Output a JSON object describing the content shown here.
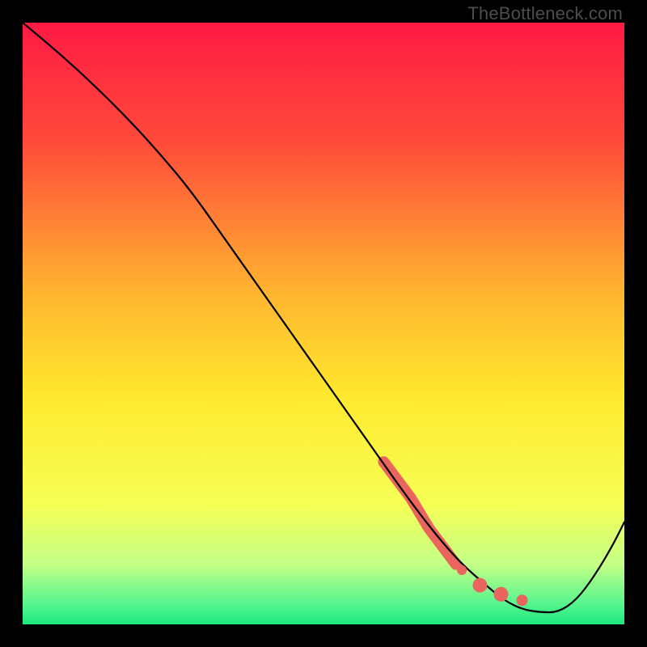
{
  "watermark": "TheBottleneck.com",
  "chart_data": {
    "type": "line",
    "title": "",
    "xlabel": "",
    "ylabel": "",
    "xlim": [
      0,
      100
    ],
    "ylim": [
      0,
      100
    ],
    "grid": false,
    "background_gradient": {
      "stops": [
        {
          "pos": 0.0,
          "color": "#ff1a44"
        },
        {
          "pos": 0.2,
          "color": "#ff4b3a"
        },
        {
          "pos": 0.45,
          "color": "#ffb530"
        },
        {
          "pos": 0.62,
          "color": "#ffe92e"
        },
        {
          "pos": 0.8,
          "color": "#f6ff55"
        },
        {
          "pos": 0.9,
          "color": "#c4ff86"
        },
        {
          "pos": 0.965,
          "color": "#57f58e"
        },
        {
          "pos": 1.0,
          "color": "#1ee87f"
        }
      ]
    },
    "series": [
      {
        "name": "curve",
        "x": [
          0.0,
          6.0,
          12.0,
          18.0,
          23.0,
          28.0,
          34.0,
          40.0,
          46.0,
          52.0,
          58.0,
          64.0,
          69.0,
          73.0,
          77.0,
          80.0,
          83.0,
          86.0,
          89.0,
          92.0,
          95.0,
          98.0,
          100.0
        ],
        "y": [
          100.0,
          95.0,
          89.5,
          83.5,
          78.0,
          72.0,
          63.5,
          55.0,
          46.5,
          38.0,
          29.5,
          21.0,
          14.5,
          10.0,
          6.5,
          4.0,
          2.5,
          2.0,
          2.0,
          4.0,
          8.0,
          13.0,
          17.0
        ],
        "color": "#000000",
        "width": 2.2
      }
    ],
    "highlight_segments": [
      {
        "name": "thick-band",
        "x": [
          60.0,
          61.5,
          63.0,
          64.5,
          66.0,
          67.5,
          69.0,
          70.5,
          72.0
        ],
        "y": [
          27.0,
          25.0,
          23.0,
          21.0,
          18.5,
          16.0,
          14.0,
          12.0,
          10.0
        ],
        "color": "#e9655e",
        "width": 14
      }
    ],
    "points": [
      {
        "x": 73.0,
        "y": 9.0,
        "r": 6,
        "color": "#e9655e"
      },
      {
        "x": 76.0,
        "y": 6.5,
        "r": 9,
        "color": "#e9655e"
      },
      {
        "x": 79.5,
        "y": 5.0,
        "r": 9,
        "color": "#e9655e"
      },
      {
        "x": 83.0,
        "y": 4.0,
        "r": 7,
        "color": "#e9655e"
      }
    ]
  }
}
